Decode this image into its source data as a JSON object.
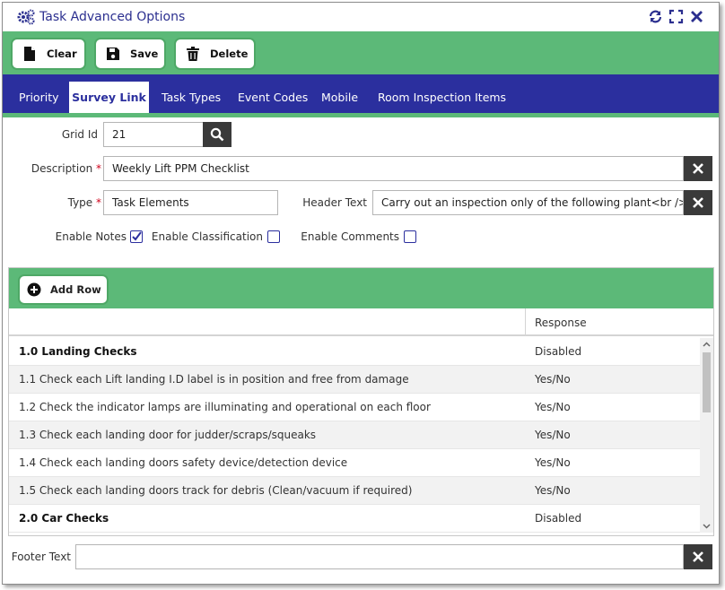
{
  "window": {
    "title": "Task Advanced Options",
    "icons": [
      "gears-icon",
      "refresh-icon",
      "fullscreen-icon",
      "close-icon"
    ]
  },
  "toolbar": {
    "clear_label": "Clear",
    "save_label": "Save",
    "delete_label": "Delete"
  },
  "tabs": [
    {
      "label": "Priority",
      "active": false
    },
    {
      "label": "Survey Link",
      "active": true
    },
    {
      "label": "Task Types",
      "active": false
    },
    {
      "label": "Event Codes",
      "active": false
    },
    {
      "label": "Mobile",
      "active": false
    },
    {
      "label": "Room Inspection Items",
      "active": false
    }
  ],
  "form": {
    "grid_id_label": "Grid Id",
    "grid_id_value": "21",
    "description_label": "Description",
    "description_value": "Weekly Lift PPM Checklist",
    "type_label": "Type",
    "type_value": "Task Elements",
    "header_text_label": "Header Text",
    "header_text_value": "Carry out an inspection only of the following plant<br />Ob",
    "required_marker": "*",
    "enable_notes_label": "Enable Notes",
    "enable_notes_checked": true,
    "enable_classification_label": "Enable Classification",
    "enable_classification_checked": false,
    "enable_comments_label": "Enable Comments",
    "enable_comments_checked": false,
    "footer_text_label": "Footer Text",
    "footer_text_value": ""
  },
  "grid": {
    "add_row_label": "Add Row",
    "columns": [
      "",
      "Response"
    ],
    "rows": [
      {
        "item": "1.0 Landing Checks",
        "response": "Disabled",
        "heading": true
      },
      {
        "item": "1.1 Check each Lift landing I.D label is in position and free from damage",
        "response": "Yes/No",
        "heading": false
      },
      {
        "item": "1.2 Check the indicator lamps are illuminating and operational on each floor",
        "response": "Yes/No",
        "heading": false
      },
      {
        "item": "1.3 Check each landing door for judder/scraps/squeaks",
        "response": "Yes/No",
        "heading": false
      },
      {
        "item": "1.4 Check each landing doors safety device/detection device",
        "response": "Yes/No",
        "heading": false
      },
      {
        "item": "1.5 Check each landing doors track for debris (Clean/vacuum if required)",
        "response": "Yes/No",
        "heading": false
      },
      {
        "item": "2.0 Car Checks",
        "response": "Disabled",
        "heading": true
      }
    ]
  },
  "colors": {
    "accent_green": "#5cb978",
    "tab_blue": "#2b2f9e",
    "title_blue": "#2b2f8f",
    "required_red": "#d0021b",
    "dark_button": "#3a3a3a"
  }
}
